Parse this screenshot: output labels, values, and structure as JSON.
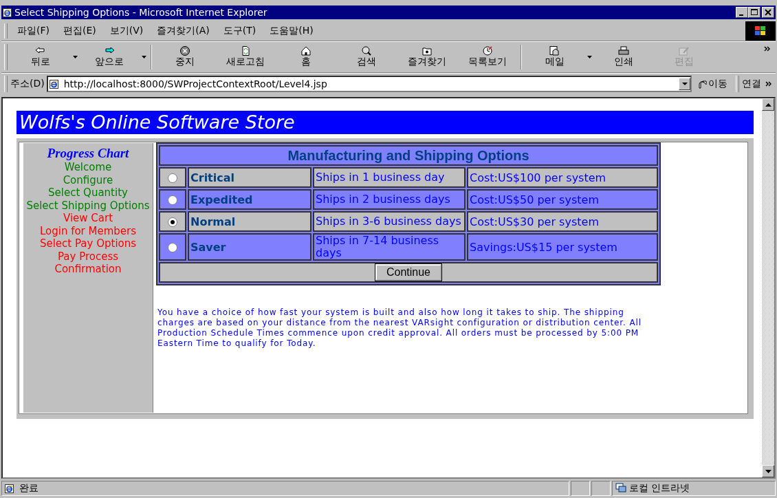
{
  "window": {
    "title": "Select Shipping Options - Microsoft Internet Explorer"
  },
  "menu": [
    "파일(F)",
    "편집(E)",
    "보기(V)",
    "즐겨찾기(A)",
    "도구(T)",
    "도움말(H)"
  ],
  "toolbar": [
    {
      "label": "뒤로",
      "dropdown": true,
      "disabled": false
    },
    {
      "label": "앞으로",
      "dropdown": true,
      "disabled": false
    },
    {
      "label": "중지",
      "dropdown": false,
      "disabled": false
    },
    {
      "label": "새로고침",
      "dropdown": false,
      "disabled": false
    },
    {
      "label": "홈",
      "dropdown": false,
      "disabled": false
    },
    {
      "label": "검색",
      "dropdown": false,
      "disabled": false
    },
    {
      "label": "즐겨찾기",
      "dropdown": false,
      "disabled": false
    },
    {
      "label": "목록보기",
      "dropdown": false,
      "disabled": false
    },
    {
      "label": "메일",
      "dropdown": true,
      "disabled": false
    },
    {
      "label": "인쇄",
      "dropdown": false,
      "disabled": false
    },
    {
      "label": "편집",
      "dropdown": false,
      "disabled": true
    }
  ],
  "address_bar": {
    "label": "주소(D)",
    "value": "http://localhost:8000/SWProjectContextRoot/Level4.jsp",
    "go": "이동",
    "links": "연결"
  },
  "page": {
    "banner": "Wolfs's Online Software Store",
    "progress": {
      "title": "Progress Chart",
      "items": [
        {
          "label": "Welcome",
          "color": "#008000"
        },
        {
          "label": "Configure",
          "color": "#008000"
        },
        {
          "label": "Select Quantity",
          "color": "#008000"
        },
        {
          "label": "Select Shipping Options",
          "color": "#008000"
        },
        {
          "label": "View Cart",
          "color": "#ff0000"
        },
        {
          "label": "Login for Members",
          "color": "#ff0000"
        },
        {
          "label": "Select Pay Options",
          "color": "#ff0000"
        },
        {
          "label": "Pay Process",
          "color": "#ff0000"
        },
        {
          "label": "Confirmation",
          "color": "#ff0000"
        }
      ]
    },
    "options": {
      "title": "Manufacturing and Shipping Options",
      "rows": [
        {
          "name": "Critical",
          "time": "Ships in 1 business day",
          "price": "Cost:US$100 per system",
          "selected": false
        },
        {
          "name": "Expedited",
          "time": "Ships in 2 business days",
          "price": "Cost:US$50 per system",
          "selected": false
        },
        {
          "name": "Normal",
          "time": "Ships in 3-6 business days",
          "price": "Cost:US$30 per system",
          "selected": true
        },
        {
          "name": "Saver",
          "time": "Ships in 7-14 business days",
          "price": "Savings:US$15 per system",
          "selected": false
        }
      ],
      "button": "Continue"
    },
    "note": "You have a choice of how fast your system is built and also how long it takes to ship. The shipping charges are based on your distance from the nearest VARsight configuration or distribution center. All Production Schedule Times commence upon credit approval. All orders must be processed by 5:00 PM Eastern Time to qualify for Today."
  },
  "status_bar": {
    "text": "완료",
    "zone": "로컬 인트라넷"
  }
}
